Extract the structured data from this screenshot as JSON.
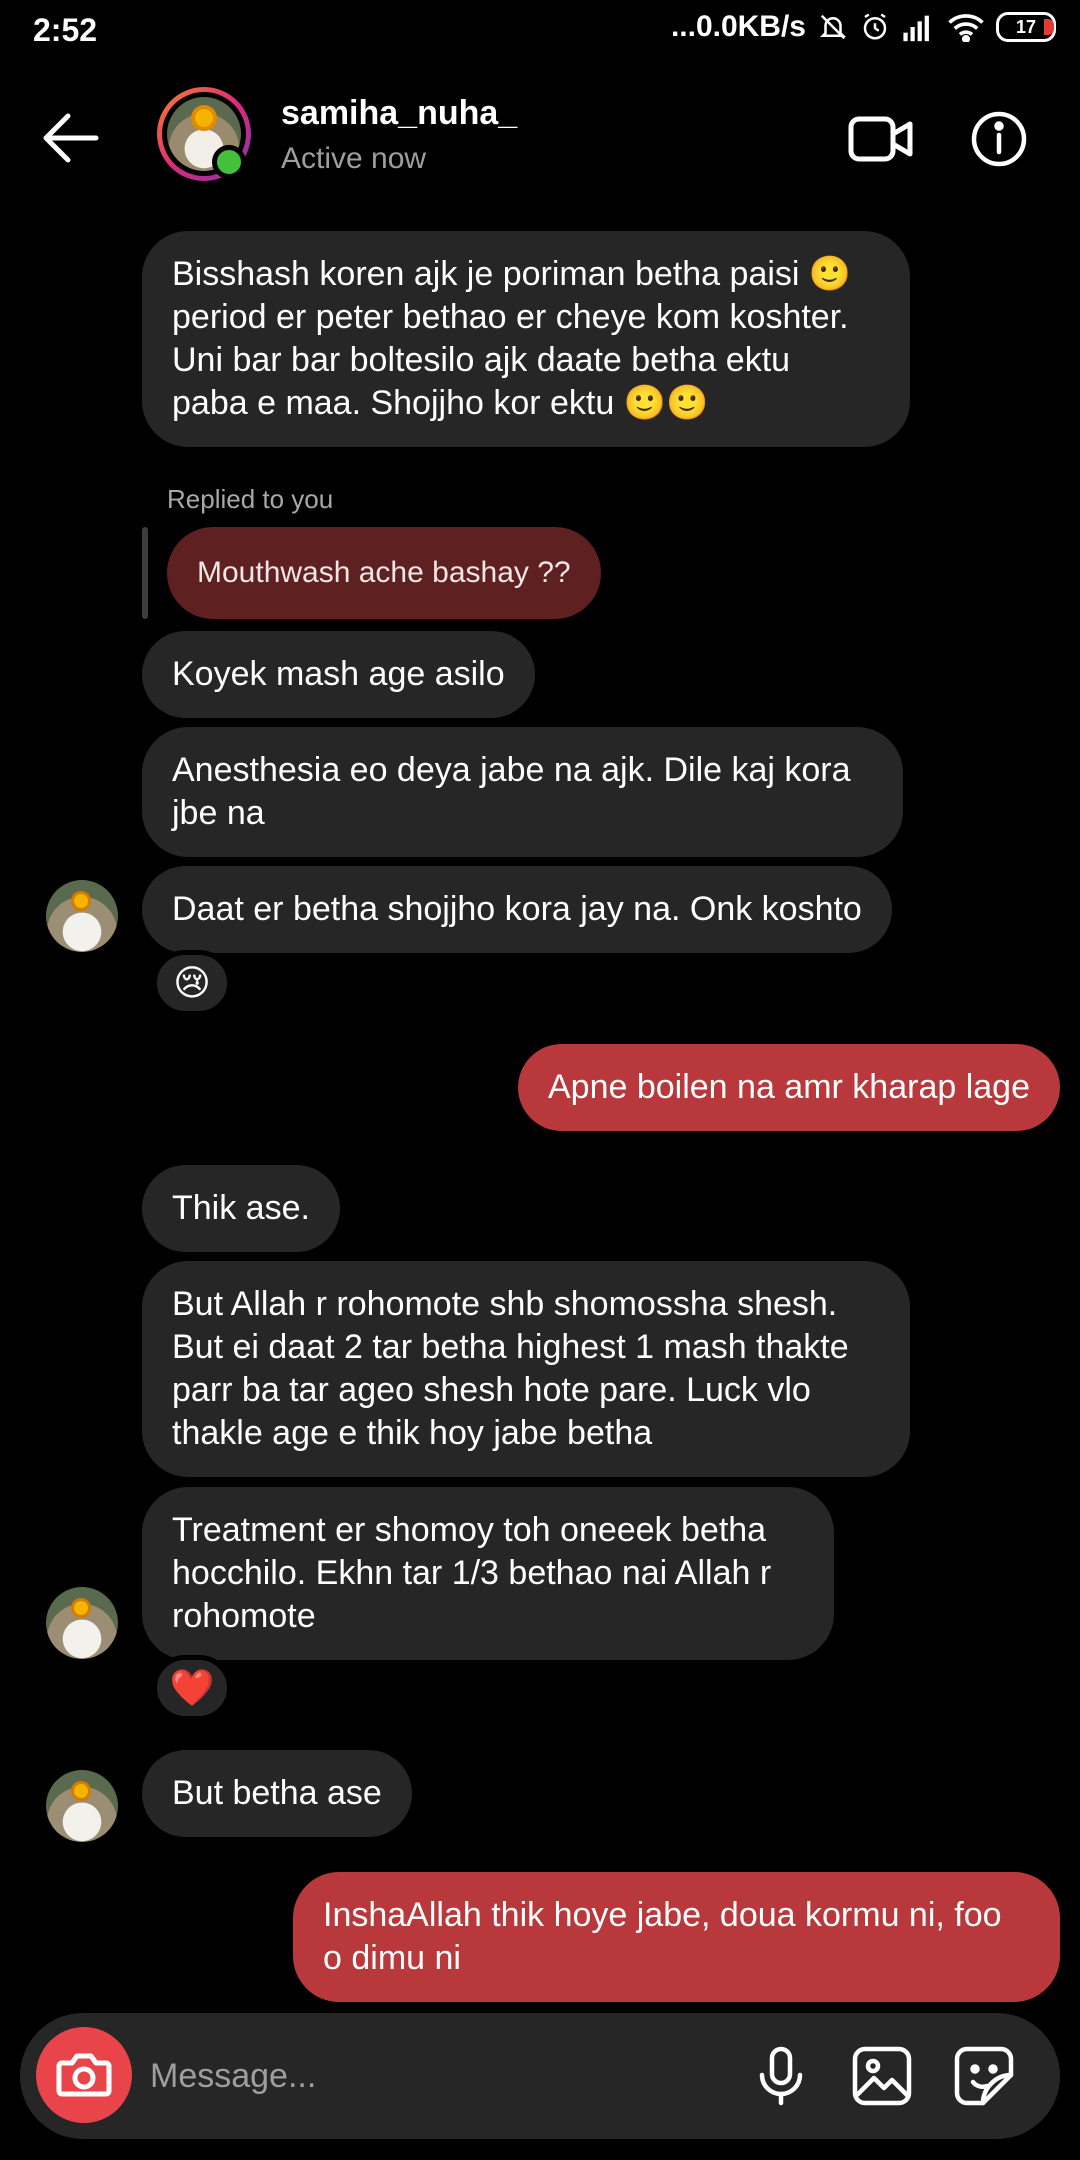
{
  "status_bar": {
    "time": "2:52",
    "network": "...0.0KB/s",
    "battery": "17"
  },
  "header": {
    "username": "samiha_nuha_",
    "activity": "Active now"
  },
  "messages": {
    "m1": "Bisshash koren ajk je poriman betha paisi 🙂\nperiod er peter bethao er cheye kom koshter.\nUni bar bar boltesilo ajk daate betha ektu\npaba e maa. Shojjho kor ektu 🙂🙂",
    "reply_label": "Replied to you",
    "reply_quote": "Mouthwash ache bashay ??",
    "m2": "Koyek mash age asilo",
    "m3": "Anesthesia eo deya jabe na ajk. Dile kaj kora\njbe na",
    "m4": "Daat er betha shojjho kora jay na. Onk koshto",
    "m4_reaction": "😢",
    "m5": "Apne boilen na amr kharap lage",
    "m6": "Thik ase.",
    "m7": "But Allah r rohomote shb shomossha shesh.\nBut ei daat 2 tar betha highest 1 mash thakte\nparr ba tar ageo shesh hote pare. Luck vlo\nthakle age e thik hoy jabe betha",
    "m8": "Treatment er shomoy toh oneeek betha\nhocchilo. Ekhn tar 1/3 bethao nai Allah r\nrohomote",
    "m8_reaction": "❤️",
    "m9": "But betha ase",
    "m10": "InshaAllah thik hoye jabe, doua kormu ni, foo\no dimu ni"
  },
  "composer": {
    "placeholder": "Message..."
  },
  "colors": {
    "sent_bubble": "#b8383b",
    "received_bubble": "#262626",
    "online": "#44c13a",
    "camera_button": "#e84449"
  }
}
